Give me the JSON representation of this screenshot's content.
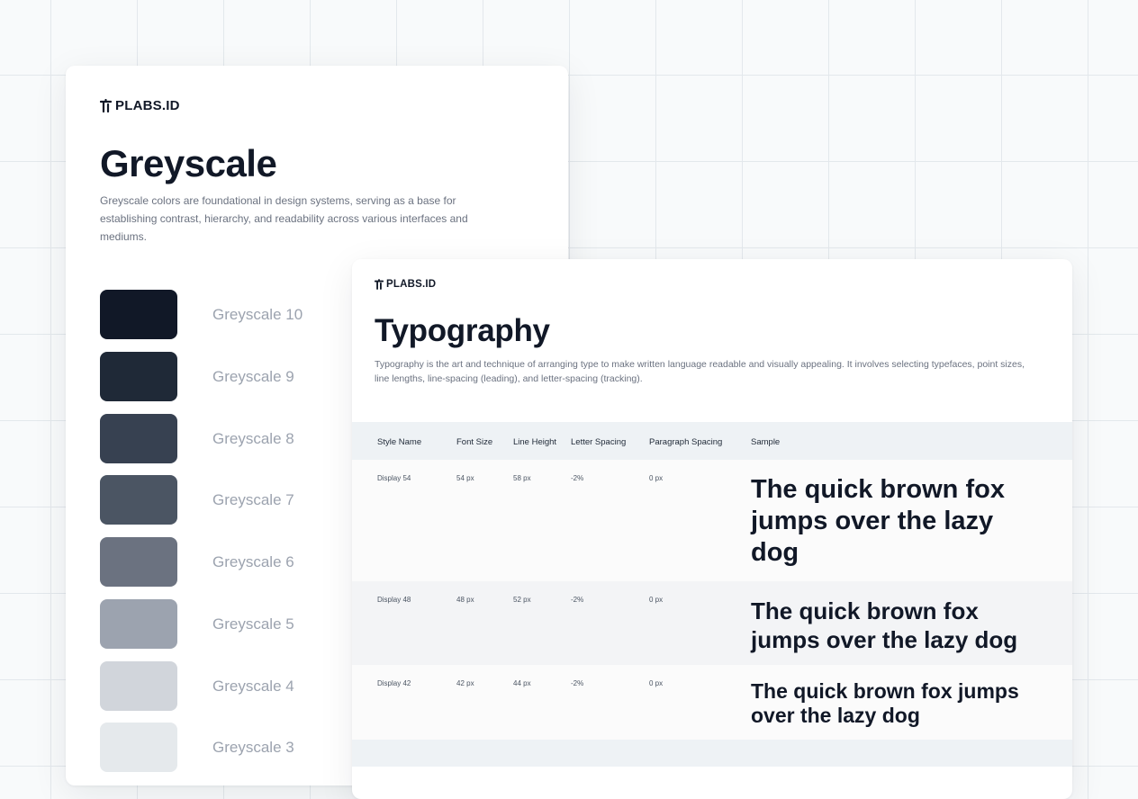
{
  "brand": {
    "name": "PLABS.ID",
    "icon": "plabs-logo-icon"
  },
  "greyscale_card": {
    "title": "Greyscale",
    "description": "Greyscale colors are foundational in design systems, serving as a base  for establishing contrast, hierarchy, and readability across various  interfaces and mediums.",
    "swatches": [
      {
        "label": "Greyscale 10",
        "color": "#111827"
      },
      {
        "label": "Greyscale 9",
        "color": "#1f2937"
      },
      {
        "label": "Greyscale 8",
        "color": "#374151"
      },
      {
        "label": "Greyscale 7",
        "color": "#4b5563"
      },
      {
        "label": "Greyscale 6",
        "color": "#6b7280"
      },
      {
        "label": "Greyscale 5",
        "color": "#9ca3af"
      },
      {
        "label": "Greyscale 4",
        "color": "#d1d5db"
      },
      {
        "label": "Greyscale 3",
        "color": "#e5e9ec"
      }
    ]
  },
  "typography_card": {
    "title": "Typography",
    "description": "Typography is the art and technique of arranging type to make written language readable and visually appealing. It involves selecting  typefaces, point sizes, line lengths, line-spacing (leading), and  letter-spacing (tracking).",
    "table": {
      "headers": [
        "Style Name",
        "Font Size",
        "Line Height",
        "Letter Spacing",
        "Paragraph Spacing",
        "Sample"
      ],
      "rows": [
        {
          "style": "Display 54",
          "font_size": "54 px",
          "line_height": "58 px",
          "letter_spacing": "-2%",
          "paragraph_spacing": "0 px",
          "sample": "The quick brown fox jumps over the lazy dog"
        },
        {
          "style": "Display 48",
          "font_size": "48 px",
          "line_height": "52 px",
          "letter_spacing": "-2%",
          "paragraph_spacing": "0 px",
          "sample": "The quick brown fox jumps over the lazy dog"
        },
        {
          "style": "Display 42",
          "font_size": "42 px",
          "line_height": "44 px",
          "letter_spacing": "-2%",
          "paragraph_spacing": "0 px",
          "sample": "The quick brown fox jumps over the lazy dog"
        }
      ]
    }
  },
  "colors": {
    "background": "#f8fafb",
    "card": "#ffffff",
    "text_primary": "#111827",
    "text_muted": "#6b7280",
    "table_header": "#eef2f5"
  }
}
